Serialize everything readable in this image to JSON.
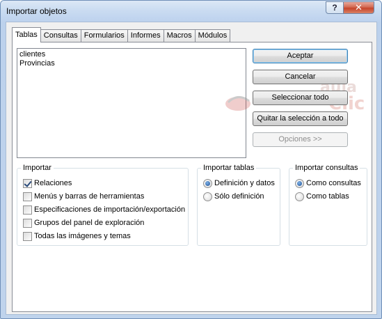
{
  "window": {
    "title": "Importar objetos",
    "help_label": "?",
    "close_label": "✕"
  },
  "tabs": [
    {
      "label": "Tablas",
      "active": true
    },
    {
      "label": "Consultas"
    },
    {
      "label": "Formularios"
    },
    {
      "label": "Informes"
    },
    {
      "label": "Macros"
    },
    {
      "label": "Módulos"
    }
  ],
  "list": {
    "items": [
      "clientes",
      "Provincias"
    ]
  },
  "buttons": {
    "accept": "Aceptar",
    "cancel": "Cancelar",
    "select_all": "Seleccionar todo",
    "deselect_all": "Quitar la selección a todo",
    "options": "Opciones >>"
  },
  "watermark": {
    "line1": "aula",
    "line2": "Clic"
  },
  "importar": {
    "title": "Importar",
    "options": [
      {
        "label": "Relaciones",
        "checked": true
      },
      {
        "label": "Menús y barras de herramientas",
        "checked": false
      },
      {
        "label": "Especificaciones de importación/exportación",
        "checked": false
      },
      {
        "label": "Grupos del panel de exploración",
        "checked": false
      },
      {
        "label": "Todas las imágenes y temas",
        "checked": false
      }
    ]
  },
  "importar_tablas": {
    "title": "Importar tablas",
    "options": [
      {
        "label": "Definición y datos",
        "selected": true
      },
      {
        "label": "Sólo definición",
        "selected": false
      }
    ]
  },
  "importar_consultas": {
    "title": "Importar consultas",
    "options": [
      {
        "label": "Como consultas",
        "selected": true
      },
      {
        "label": "Como tablas",
        "selected": false
      }
    ]
  },
  "colors": {
    "title_bar": "#c9dbf1",
    "close_button": "#c6452b",
    "panel_border": "#898c95"
  }
}
